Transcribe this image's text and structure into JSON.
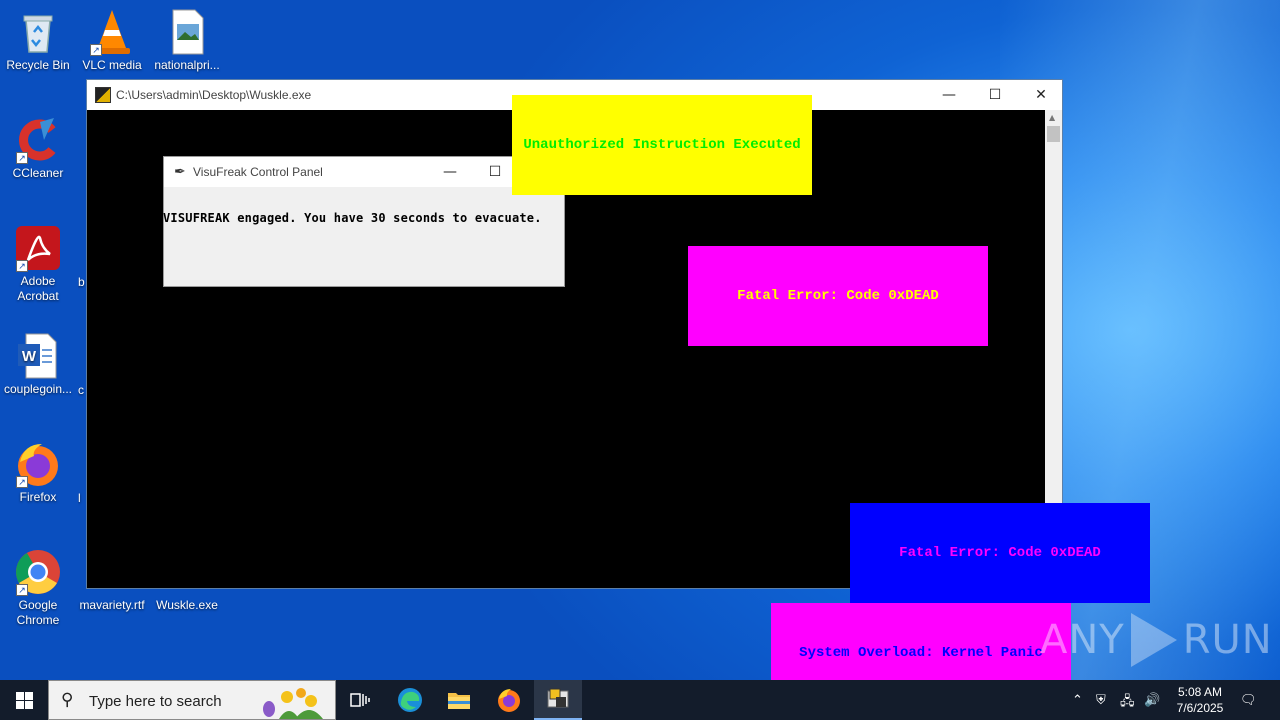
{
  "desktop": {
    "icons": [
      {
        "label": "Recycle Bin"
      },
      {
        "label": "VLC media"
      },
      {
        "label": "nationalpri..."
      },
      {
        "label": "CCleaner"
      },
      {
        "label": "Adobe Acrobat"
      },
      {
        "label": "b"
      },
      {
        "label": "couplegoin..."
      },
      {
        "label": "c"
      },
      {
        "label": "Firefox"
      },
      {
        "label": "l"
      },
      {
        "label": "Google Chrome"
      },
      {
        "label": "mavariety.rtf"
      },
      {
        "label": "Wuskle.exe"
      }
    ]
  },
  "console_window": {
    "title": "C:\\Users\\admin\\Desktop\\Wuskle.exe",
    "minimize": "—",
    "maximize": "☐",
    "close": "✕"
  },
  "control_panel": {
    "title": "VisuFreak Control Panel",
    "message": "VISUFREAK engaged. You have 30 seconds to evacuate.",
    "minimize": "—",
    "maximize": "☐"
  },
  "popups": [
    {
      "text": "Unauthorized Instruction Executed",
      "bg": "#ffff00",
      "fg": "#00ee00"
    },
    {
      "text": "Fatal Error: Code 0xDEAD",
      "bg": "#ff00ff",
      "fg": "#ffff00"
    },
    {
      "text": "Fatal Error: Code 0xDEAD",
      "bg": "#0000ff",
      "fg": "#ff00ff"
    },
    {
      "text": "System Overload: Kernel Panic",
      "bg": "#ff00ff",
      "fg": "#0000ff"
    }
  ],
  "watermark": {
    "left": "ANY",
    "right": "RUN"
  },
  "taskbar": {
    "search_placeholder": "Type here to search",
    "time": "5:08 AM",
    "date": "7/6/2025"
  },
  "colors": {
    "taskbar": "#131c2b",
    "desktop_accent": "#0f63d4"
  }
}
